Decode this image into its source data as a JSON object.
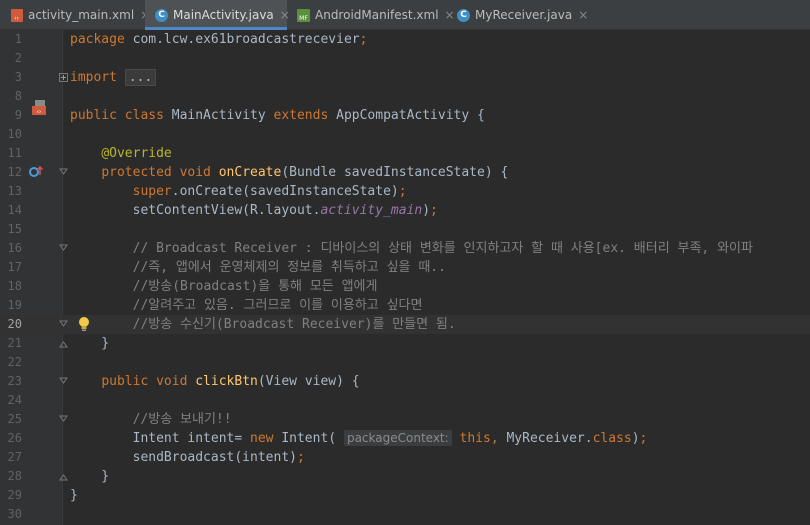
{
  "tabs": [
    {
      "label": "activity_main.xml",
      "icon": "xml-file-icon",
      "active": false
    },
    {
      "label": "MainActivity.java",
      "icon": "java-class-icon",
      "active": true
    },
    {
      "label": "AndroidManifest.xml",
      "icon": "manifest-file-icon",
      "active": false
    },
    {
      "label": "MyReceiver.java",
      "icon": "java-class-icon",
      "active": false
    }
  ],
  "tab_close_glyph": "×",
  "current_line": 20,
  "lines": [
    {
      "n": "1",
      "tokens": [
        {
          "t": "package ",
          "c": "kw"
        },
        {
          "t": "com.lcw.ex61broadcastrecevier",
          "c": ""
        },
        {
          "t": ";",
          "c": "kw"
        }
      ]
    },
    {
      "n": "2",
      "tokens": []
    },
    {
      "n": "3",
      "tokens": [
        {
          "t": "import ",
          "c": "kw"
        },
        {
          "t": "...",
          "c": "fold"
        }
      ]
    },
    {
      "n": "8",
      "tokens": []
    },
    {
      "n": "9",
      "tokens": [
        {
          "t": "public class ",
          "c": "kw"
        },
        {
          "t": "MainActivity ",
          "c": ""
        },
        {
          "t": "extends ",
          "c": "kw"
        },
        {
          "t": "AppCompatActivity {",
          "c": ""
        }
      ]
    },
    {
      "n": "10",
      "tokens": []
    },
    {
      "n": "11",
      "tokens": [
        {
          "t": "    ",
          "c": ""
        },
        {
          "t": "@Override",
          "c": "an"
        }
      ]
    },
    {
      "n": "12",
      "tokens": [
        {
          "t": "    ",
          "c": ""
        },
        {
          "t": "protected void ",
          "c": "kw"
        },
        {
          "t": "onCreate",
          "c": "fn"
        },
        {
          "t": "(Bundle savedInstanceState) {",
          "c": ""
        }
      ]
    },
    {
      "n": "13",
      "tokens": [
        {
          "t": "        ",
          "c": ""
        },
        {
          "t": "super",
          "c": "kw"
        },
        {
          "t": ".onCreate(savedInstanceState)",
          "c": ""
        },
        {
          "t": ";",
          "c": "kw"
        }
      ]
    },
    {
      "n": "14",
      "tokens": [
        {
          "t": "        setContentView(R.layout.",
          "c": ""
        },
        {
          "t": "activity_main",
          "c": "it"
        },
        {
          "t": ")",
          "c": ""
        },
        {
          "t": ";",
          "c": "kw"
        }
      ]
    },
    {
      "n": "15",
      "tokens": []
    },
    {
      "n": "16",
      "tokens": [
        {
          "t": "        ",
          "c": ""
        },
        {
          "t": "// Broadcast Receiver : 디바이스의 상태 변화를 인지하고자 할 때 사용[ex. 배터리 부족, 와이파",
          "c": "cm"
        }
      ]
    },
    {
      "n": "17",
      "tokens": [
        {
          "t": "        ",
          "c": ""
        },
        {
          "t": "//즉, 앱에서 운영체제의 정보를 취득하고 싶을 때..",
          "c": "cm"
        }
      ]
    },
    {
      "n": "18",
      "tokens": [
        {
          "t": "        ",
          "c": ""
        },
        {
          "t": "//방송(Broadcast)을 통해 모든 앱에게",
          "c": "cm"
        }
      ]
    },
    {
      "n": "19",
      "tokens": [
        {
          "t": "        ",
          "c": ""
        },
        {
          "t": "//알려주고 있음. 그러므로 이를 이용하고 싶다면",
          "c": "cm"
        }
      ]
    },
    {
      "n": "20",
      "tokens": [
        {
          "t": "        ",
          "c": ""
        },
        {
          "t": "//방송 수신기(Broadcast Receiver)를 만들면 됨.",
          "c": "cm"
        }
      ]
    },
    {
      "n": "21",
      "tokens": [
        {
          "t": "    }",
          "c": ""
        }
      ]
    },
    {
      "n": "22",
      "tokens": []
    },
    {
      "n": "23",
      "tokens": [
        {
          "t": "    ",
          "c": ""
        },
        {
          "t": "public void ",
          "c": "kw"
        },
        {
          "t": "clickBtn",
          "c": "fn"
        },
        {
          "t": "(View view) {",
          "c": ""
        }
      ]
    },
    {
      "n": "24",
      "tokens": []
    },
    {
      "n": "25",
      "tokens": [
        {
          "t": "        ",
          "c": ""
        },
        {
          "t": "//방송 보내기!!",
          "c": "cm"
        }
      ]
    },
    {
      "n": "26",
      "tokens": [
        {
          "t": "        Intent intent= ",
          "c": ""
        },
        {
          "t": "new ",
          "c": "kw"
        },
        {
          "t": "Intent( ",
          "c": ""
        },
        {
          "t": "packageContext:",
          "c": "hint"
        },
        {
          "t": " ",
          "c": ""
        },
        {
          "t": "this",
          "c": "kw"
        },
        {
          "t": ", ",
          "c": "kw"
        },
        {
          "t": "MyReceiver.",
          "c": ""
        },
        {
          "t": "class",
          "c": "kw"
        },
        {
          "t": ")",
          "c": ""
        },
        {
          "t": ";",
          "c": "kw"
        }
      ]
    },
    {
      "n": "27",
      "tokens": [
        {
          "t": "        sendBroadcast(intent)",
          "c": ""
        },
        {
          "t": ";",
          "c": "kw"
        }
      ]
    },
    {
      "n": "28",
      "tokens": [
        {
          "t": "    }",
          "c": ""
        }
      ]
    },
    {
      "n": "29",
      "tokens": [
        {
          "t": "}",
          "c": ""
        }
      ]
    },
    {
      "n": "30",
      "tokens": []
    }
  ],
  "gutter_icons": {
    "9": "layout-link-icon",
    "12": "override-method-icon",
    "20": "intention-bulb-icon"
  },
  "fold_lines": [
    "3",
    "12",
    "16",
    "20",
    "21",
    "23",
    "25",
    "28"
  ],
  "colors": {
    "keyword": "#cc7832",
    "method": "#ffc66d",
    "annotation": "#bbb529",
    "field": "#9876aa",
    "comment": "#808080",
    "text": "#a9b7c6",
    "active_tab_underline": "#4a88c7"
  }
}
